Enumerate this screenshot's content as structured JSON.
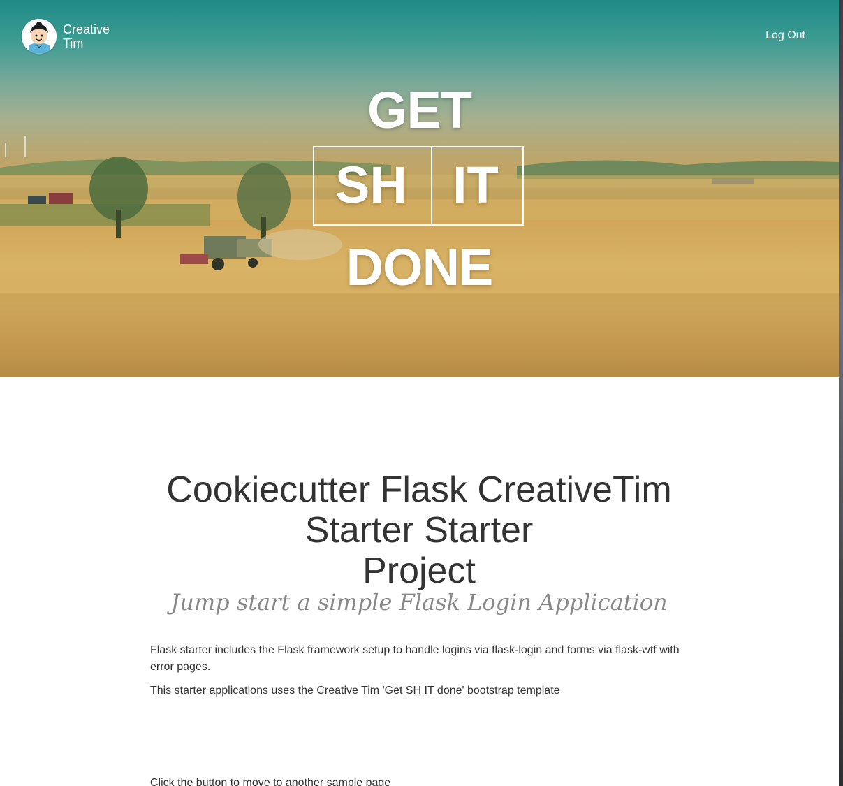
{
  "navbar": {
    "brand_line1": "Creative",
    "brand_line2": "Tim",
    "logout_label": "Log Out"
  },
  "hero": {
    "line_top": "GET",
    "box_left": "SH",
    "box_right": "IT",
    "line_bottom": "DONE"
  },
  "content": {
    "title_line1": "Cookiecutter Flask CreativeTim",
    "title_line2": "Starter Starter",
    "title_line3": "Project",
    "subtitle": "Jump start a simple Flask Login Application",
    "paragraph1": "Flask starter includes the Flask framework setup to handle logins via flask-login and forms via flask-wtf with error pages.",
    "paragraph2": "This starter applications uses the Creative Tim 'Get SH IT done' bootstrap template",
    "paragraph3": "Click the button to move to another sample page"
  },
  "colors": {
    "text": "#333333",
    "subtitle": "#888888",
    "hero_text": "#ffffff"
  }
}
